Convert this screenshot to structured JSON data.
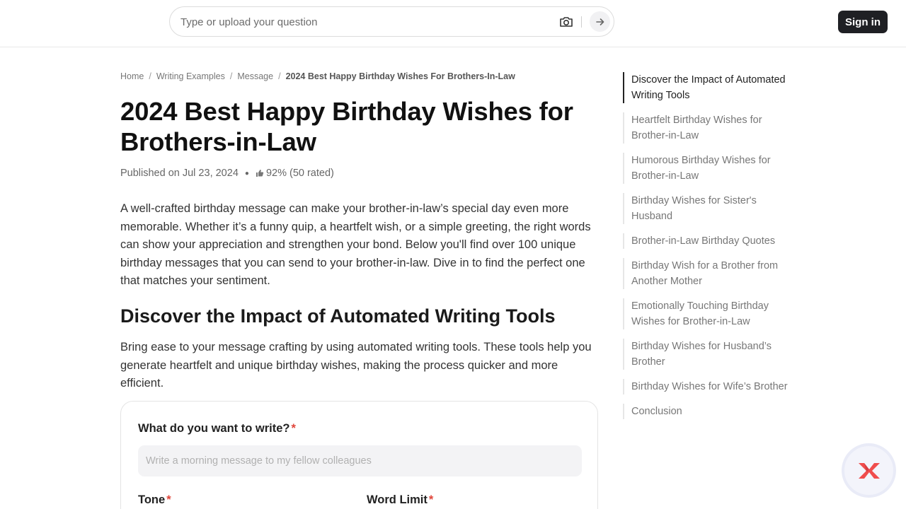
{
  "header": {
    "search_placeholder": "Type or upload your question",
    "signin_label": "Sign in"
  },
  "breadcrumb": [
    {
      "label": "Home"
    },
    {
      "label": "Writing Examples"
    },
    {
      "label": "Message"
    },
    {
      "label": "2024 Best Happy Birthday Wishes For Brothers-In-Law"
    }
  ],
  "breadcrumb_sep": "/",
  "article": {
    "title": "2024 Best Happy Birthday Wishes for Brothers-in-Law",
    "published": "Published on Jul 23, 2024",
    "rating": "92% (50 rated)",
    "intro": "A well-crafted birthday message can make your brother-in-law’s special day even more memorable. Whether it’s a funny quip, a heartfelt wish, or a simple greeting, the right words can show your appreciation and strengthen your bond. Below you'll find over 100 unique birthday messages that you can send to your brother-in-law. Dive in to find the perfect one that matches your sentiment.",
    "section_heading": "Discover the Impact of Automated Writing Tools",
    "section_text": "Bring ease to your message crafting by using automated writing tools. These tools help you generate heartfelt and unique birthday wishes, making the process quicker and more efficient."
  },
  "form": {
    "question_label": "What do you want to write?",
    "question_placeholder": "Write a morning message to my fellow colleagues",
    "tone_label": "Tone",
    "word_limit_label": "Word Limit",
    "required_mark": "*"
  },
  "toc": [
    {
      "label": "Discover the Impact of Automated Writing Tools",
      "active": true
    },
    {
      "label": "Heartfelt Birthday Wishes for Brother-in-Law",
      "active": false
    },
    {
      "label": "Humorous Birthday Wishes for Brother-in-Law",
      "active": false
    },
    {
      "label": "Birthday Wishes for Sister's Husband",
      "active": false
    },
    {
      "label": "Brother-in-Law Birthday Quotes",
      "active": false
    },
    {
      "label": "Birthday Wish for a Brother from Another Mother",
      "active": false
    },
    {
      "label": "Emotionally Touching Birthday Wishes for Brother-in-Law",
      "active": false
    },
    {
      "label": "Birthday Wishes for Husband’s Brother",
      "active": false
    },
    {
      "label": "Birthday Wishes for Wife’s Brother",
      "active": false
    },
    {
      "label": "Conclusion",
      "active": false
    }
  ],
  "colors": {
    "accent_dark": "#1f2024",
    "required_red": "#e0453a",
    "logo_red": "#f04d4d"
  },
  "icons": {
    "camera": "camera-icon",
    "send": "arrow-right-icon",
    "thumb": "thumbs-up-icon",
    "floating": "brand-logo-icon"
  }
}
